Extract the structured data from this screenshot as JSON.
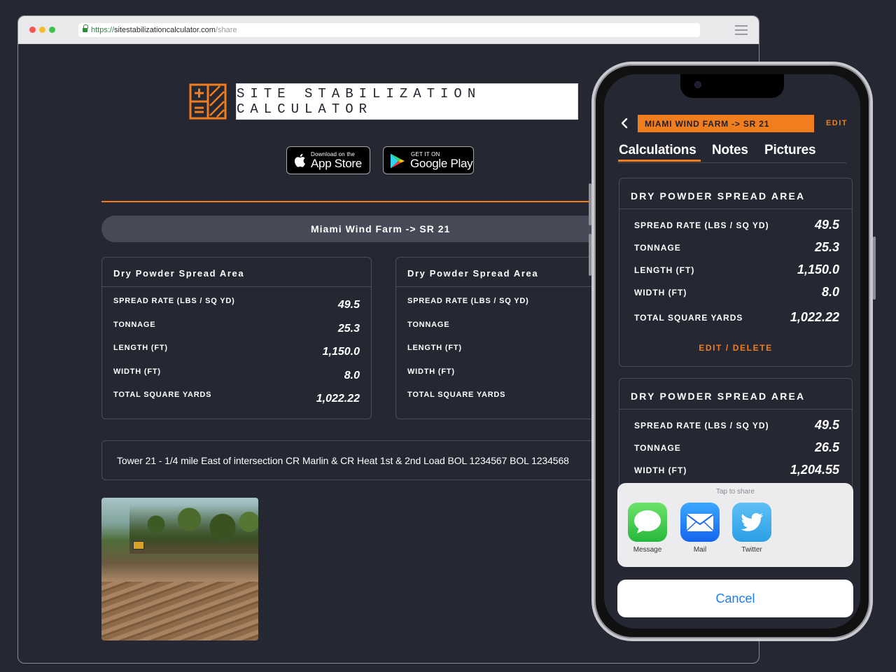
{
  "browser": {
    "url_scheme": "https://",
    "url_host": "sitestabilizationcalculator.com",
    "url_path": "/share"
  },
  "header": {
    "title": "SITE STABILIZATION CALCULATOR"
  },
  "stores": {
    "apple_small": "Download on the",
    "apple_big": "App Store",
    "google_small": "GET IT ON",
    "google_big": "Google Play"
  },
  "project": {
    "name": "Miami Wind Farm -> SR 21"
  },
  "cards": [
    {
      "title": "Dry Powder Spread Area",
      "rows": [
        {
          "label": "SPREAD RATE (LBS / SQ YD)",
          "value": "49.5"
        },
        {
          "label": "TONNAGE",
          "value": "25.3"
        },
        {
          "label": "LENGTH (FT)",
          "value": "1,150.0"
        },
        {
          "label": "WIDTH (FT)",
          "value": "8.0"
        },
        {
          "label": "TOTAL SQUARE YARDS",
          "value": "1,022.22"
        }
      ]
    },
    {
      "title": "Dry Powder Spread Area",
      "rows": [
        {
          "label": "SPREAD RATE (LBS / SQ YD)"
        },
        {
          "label": "TONNAGE"
        },
        {
          "label": "LENGTH (FT)"
        },
        {
          "label": "WIDTH (FT)"
        },
        {
          "label": "TOTAL SQUARE YARDS"
        }
      ]
    }
  ],
  "notes": "Tower 21 - 1/4 mile East of intersection CR Marlin & CR Heat 1st & 2nd Load BOL 1234567 BOL 1234568",
  "phone": {
    "project": "MIAMI WIND FARM -> SR 21",
    "edit": "EDIT",
    "tabs": [
      "Calculations",
      "Notes",
      "Pictures"
    ],
    "cards": [
      {
        "title": "DRY POWDER SPREAD AREA",
        "rows": [
          {
            "label": "SPREAD RATE (LBS / SQ YD)",
            "value": "49.5"
          },
          {
            "label": "TONNAGE",
            "value": "25.3"
          },
          {
            "label": "LENGTH (FT)",
            "value": "1,150.0"
          },
          {
            "label": "WIDTH (FT)",
            "value": "8.0"
          },
          {
            "label": "TOTAL SQUARE YARDS",
            "value": "1,022.22"
          }
        ],
        "action": "EDIT / DELETE"
      },
      {
        "title": "DRY POWDER SPREAD AREA",
        "rows": [
          {
            "label": "SPREAD RATE (LBS / SQ YD)",
            "value": "49.5"
          },
          {
            "label": "TONNAGE",
            "value": "26.5"
          },
          {
            "label": "WIDTH (FT)",
            "value": "1,204.55"
          }
        ]
      }
    ],
    "share": {
      "title": "Tap to share",
      "apps": [
        "Message",
        "Mail",
        "Twitter"
      ],
      "cancel": "Cancel"
    }
  },
  "colors": {
    "accent": "#f07e1e",
    "background": "#252733",
    "pill": "#474a56",
    "ios_blue": "#1a7ef0"
  }
}
